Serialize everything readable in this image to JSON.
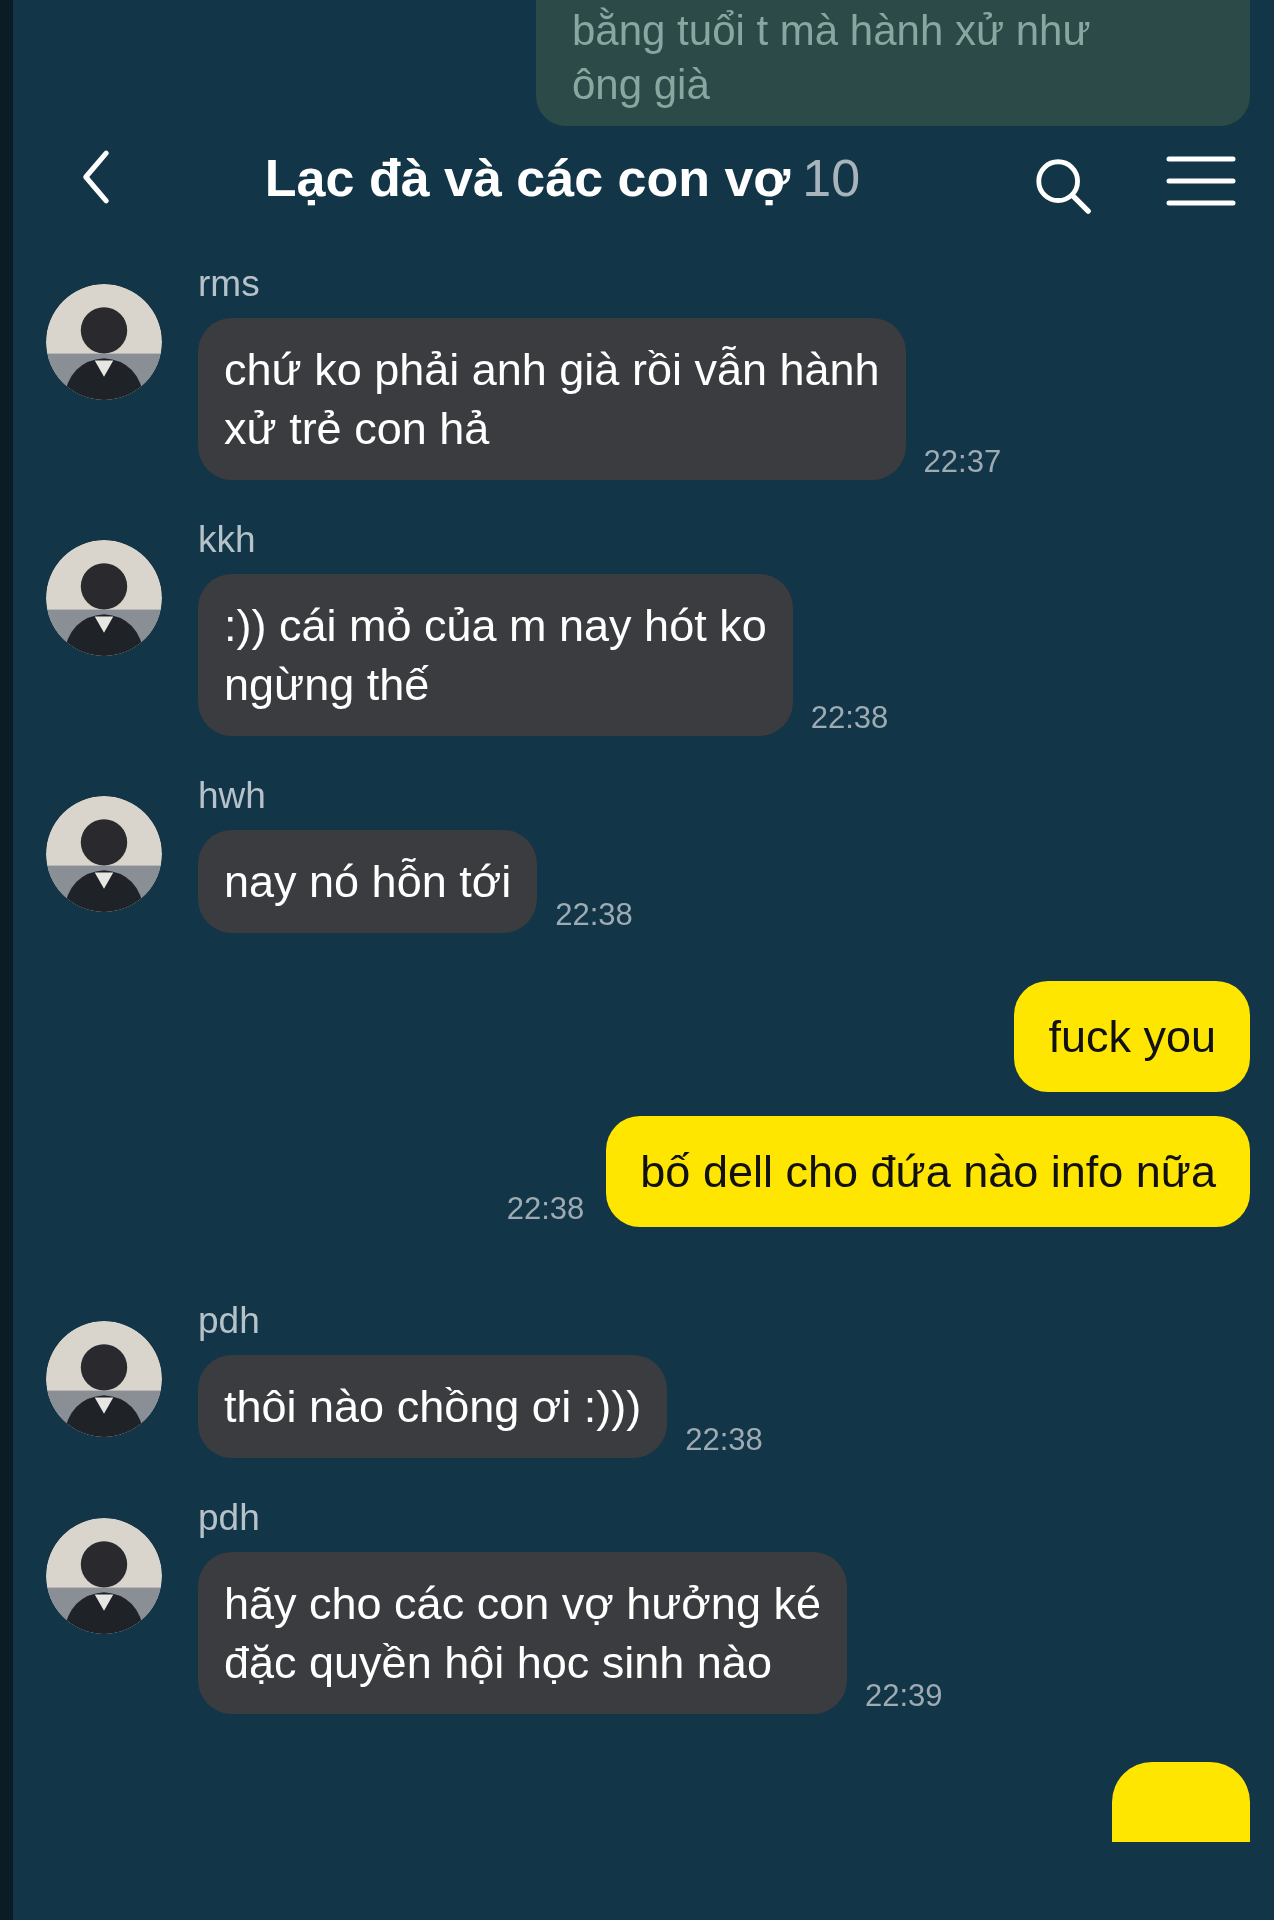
{
  "header": {
    "title": "Lạc đà và các con vợ",
    "member_count": "10"
  },
  "messages": [
    {
      "kind": "faded",
      "lines": [
        "bằng tuổi t mà hành xử như",
        "ông già"
      ]
    },
    {
      "kind": "other",
      "sender": "rms",
      "lines": [
        "chứ ko phải anh già rồi vẫn hành",
        "xử trẻ con hả"
      ],
      "time": "22:37"
    },
    {
      "kind": "other",
      "sender": "kkh",
      "lines": [
        ":)) cái mỏ của m nay hót ko",
        "ngừng thế"
      ],
      "time": "22:38"
    },
    {
      "kind": "other",
      "sender": "hwh",
      "lines": [
        "nay nó hỗn tới"
      ],
      "time": "22:38"
    },
    {
      "kind": "mine",
      "lines": [
        "fuck you"
      ]
    },
    {
      "kind": "mine",
      "lines": [
        "bố dell cho đứa nào info nữa"
      ],
      "time": "22:38"
    },
    {
      "kind": "other",
      "sender": "pdh",
      "lines": [
        "thôi nào chồng ơi :)))"
      ],
      "time": "22:38"
    },
    {
      "kind": "other",
      "sender": "pdh",
      "lines": [
        "hãy cho các con vợ hưởng ké",
        "đặc quyền hội học sinh nào"
      ],
      "time": "22:39"
    },
    {
      "kind": "mine_cut"
    }
  ]
}
